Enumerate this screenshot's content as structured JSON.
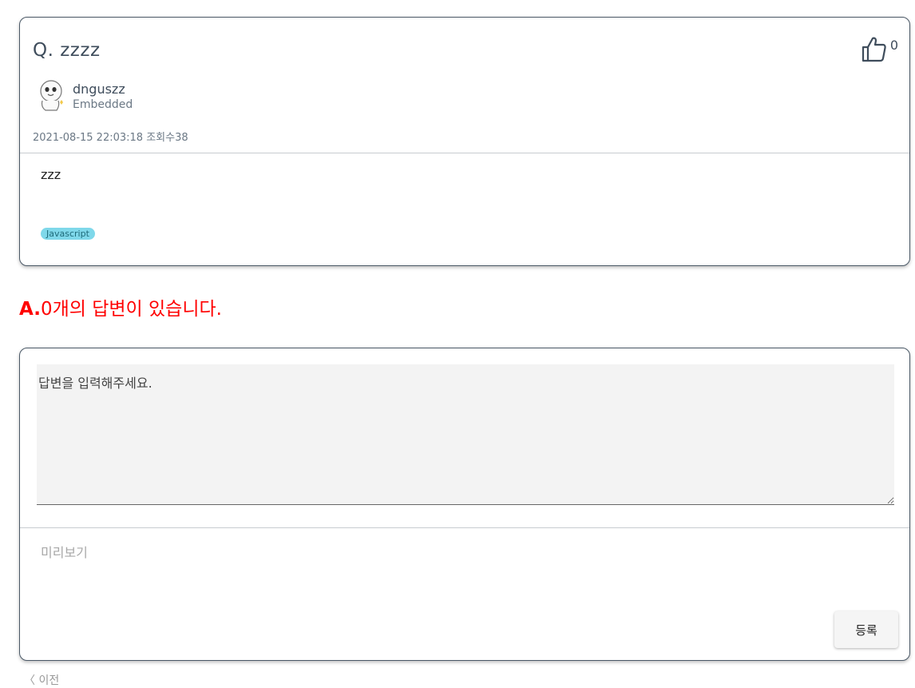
{
  "question": {
    "title": "Q. zzzz",
    "like_count": "0",
    "author": {
      "name": "dnguszz",
      "role": "Embedded"
    },
    "meta": "2021-08-15 22:03:18 조회수38",
    "body": "zzz",
    "tags": [
      "Javascript"
    ]
  },
  "answers": {
    "prefix": "A.",
    "summary": "0개의 답변이 있습니다."
  },
  "answer_form": {
    "placeholder": "답변을 입력해주세요.",
    "preview_label": "미리보기",
    "submit_label": "등록"
  },
  "nav": {
    "prev_label": "〈 이전"
  },
  "colors": {
    "accent_red": "#ff0000",
    "tag_bg": "#7fd8ea",
    "text_slate": "#3f4d5c"
  }
}
